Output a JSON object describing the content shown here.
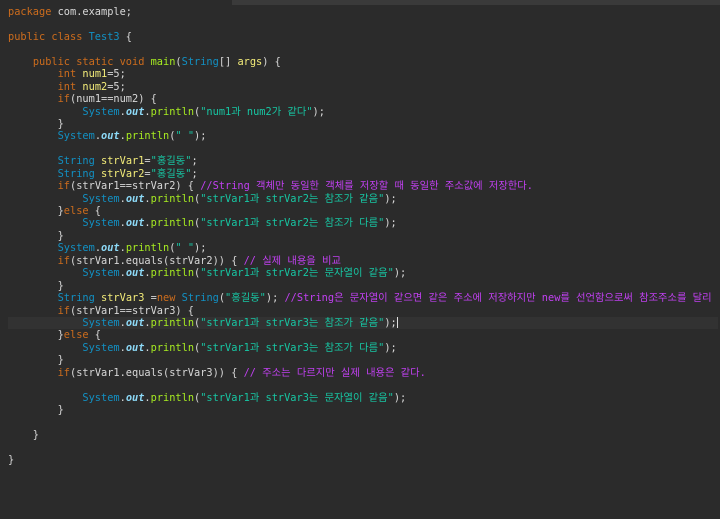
{
  "editor": {
    "language": "java",
    "colors": {
      "background": "#2b2b2b",
      "keyword": "#cc6c1d",
      "type": "#1290c3",
      "method": "#a7ec21",
      "variable": "#f3ec79",
      "field": "#8ddaf8",
      "string": "#17c6a3",
      "comment": "#c040f0"
    },
    "lines": [
      [
        [
          "kw",
          "package"
        ],
        [
          "tx",
          " com.example;"
        ]
      ],
      [],
      [
        [
          "kw",
          "public class"
        ],
        [
          "tx",
          " "
        ],
        [
          "ty",
          "Test3"
        ],
        [
          "tx",
          " {"
        ]
      ],
      [],
      [
        [
          "tx",
          "    "
        ],
        [
          "kw",
          "public static void"
        ],
        [
          "tx",
          " "
        ],
        [
          "fn",
          "main"
        ],
        [
          "tx",
          "("
        ],
        [
          "ty",
          "String"
        ],
        [
          "tx",
          "[] "
        ],
        [
          "var",
          "args"
        ],
        [
          "tx",
          ") {"
        ]
      ],
      [
        [
          "tx",
          "        "
        ],
        [
          "kw",
          "int"
        ],
        [
          "tx",
          " "
        ],
        [
          "var",
          "num1"
        ],
        [
          "tx",
          "=5;"
        ]
      ],
      [
        [
          "tx",
          "        "
        ],
        [
          "kw",
          "int"
        ],
        [
          "tx",
          " "
        ],
        [
          "var",
          "num2"
        ],
        [
          "tx",
          "=5;"
        ]
      ],
      [
        [
          "tx",
          "        "
        ],
        [
          "kw",
          "if"
        ],
        [
          "tx",
          "(num1==num2) {"
        ]
      ],
      [
        [
          "tx",
          "            "
        ],
        [
          "ty",
          "System"
        ],
        [
          "tx",
          "."
        ],
        [
          "fld",
          "out"
        ],
        [
          "tx",
          "."
        ],
        [
          "fn",
          "println"
        ],
        [
          "tx",
          "("
        ],
        [
          "str",
          "\"num1과 num2가 같다\""
        ],
        [
          "tx",
          ");"
        ]
      ],
      [
        [
          "tx",
          "        }"
        ]
      ],
      [
        [
          "tx",
          "        "
        ],
        [
          "ty",
          "System"
        ],
        [
          "tx",
          "."
        ],
        [
          "fld",
          "out"
        ],
        [
          "tx",
          "."
        ],
        [
          "fn",
          "println"
        ],
        [
          "tx",
          "("
        ],
        [
          "str",
          "\" \""
        ],
        [
          "tx",
          ");"
        ]
      ],
      [],
      [
        [
          "tx",
          "        "
        ],
        [
          "ty",
          "String"
        ],
        [
          "tx",
          " "
        ],
        [
          "var",
          "strVar1"
        ],
        [
          "tx",
          "="
        ],
        [
          "str",
          "\"홍길동\""
        ],
        [
          "tx",
          ";"
        ]
      ],
      [
        [
          "tx",
          "        "
        ],
        [
          "ty",
          "String"
        ],
        [
          "tx",
          " "
        ],
        [
          "var",
          "strVar2"
        ],
        [
          "tx",
          "="
        ],
        [
          "str",
          "\"홍길동\""
        ],
        [
          "tx",
          ";"
        ]
      ],
      [
        [
          "tx",
          "        "
        ],
        [
          "kw",
          "if"
        ],
        [
          "tx",
          "(strVar1==strVar2) { "
        ],
        [
          "cm",
          "//String 객체만 동일한 객체를 저장할 때 동일한 주소값에 저장한다."
        ]
      ],
      [
        [
          "tx",
          "            "
        ],
        [
          "ty",
          "System"
        ],
        [
          "tx",
          "."
        ],
        [
          "fld",
          "out"
        ],
        [
          "tx",
          "."
        ],
        [
          "fn",
          "println"
        ],
        [
          "tx",
          "("
        ],
        [
          "str",
          "\"strVar1과 strVar2는 참조가 같음\""
        ],
        [
          "tx",
          ");"
        ]
      ],
      [
        [
          "tx",
          "        }"
        ],
        [
          "kw",
          "else"
        ],
        [
          "tx",
          " {"
        ]
      ],
      [
        [
          "tx",
          "            "
        ],
        [
          "ty",
          "System"
        ],
        [
          "tx",
          "."
        ],
        [
          "fld",
          "out"
        ],
        [
          "tx",
          "."
        ],
        [
          "fn",
          "println"
        ],
        [
          "tx",
          "("
        ],
        [
          "str",
          "\"strVar1과 strVar2는 참조가 다름\""
        ],
        [
          "tx",
          ");"
        ]
      ],
      [
        [
          "tx",
          "        }"
        ]
      ],
      [
        [
          "tx",
          "        "
        ],
        [
          "ty",
          "System"
        ],
        [
          "tx",
          "."
        ],
        [
          "fld",
          "out"
        ],
        [
          "tx",
          "."
        ],
        [
          "fn",
          "println"
        ],
        [
          "tx",
          "("
        ],
        [
          "str",
          "\" \""
        ],
        [
          "tx",
          ");"
        ]
      ],
      [
        [
          "tx",
          "        "
        ],
        [
          "kw",
          "if"
        ],
        [
          "tx",
          "(strVar1.equals(strVar2)) { "
        ],
        [
          "cm",
          "// 실제 내용을 비교"
        ]
      ],
      [
        [
          "tx",
          "            "
        ],
        [
          "ty",
          "System"
        ],
        [
          "tx",
          "."
        ],
        [
          "fld",
          "out"
        ],
        [
          "tx",
          "."
        ],
        [
          "fn",
          "println"
        ],
        [
          "tx",
          "("
        ],
        [
          "str",
          "\"strVar1과 strVar2는 문자열이 같음\""
        ],
        [
          "tx",
          ");"
        ]
      ],
      [
        [
          "tx",
          "        }"
        ]
      ],
      [
        [
          "tx",
          "        "
        ],
        [
          "ty",
          "String"
        ],
        [
          "tx",
          " "
        ],
        [
          "var",
          "strVar3"
        ],
        [
          "tx",
          " ="
        ],
        [
          "kw",
          "new"
        ],
        [
          "tx",
          " "
        ],
        [
          "ty",
          "String"
        ],
        [
          "tx",
          "("
        ],
        [
          "str",
          "\"홍길동\""
        ],
        [
          "tx",
          "); "
        ],
        [
          "cm",
          "//String은 문자열이 같으면 같은 주소에 저장하지만 new를 선언함으로써 참조주소를 달리 저장시킬수 있다."
        ]
      ],
      [
        [
          "tx",
          "        "
        ],
        [
          "kw",
          "if"
        ],
        [
          "tx",
          "(strVar1==strVar3) {"
        ]
      ],
      [
        [
          "tx",
          "            "
        ],
        [
          "ty",
          "System"
        ],
        [
          "tx",
          "."
        ],
        [
          "fld",
          "out"
        ],
        [
          "tx",
          "."
        ],
        [
          "fn",
          "println"
        ],
        [
          "tx",
          "("
        ],
        [
          "str",
          "\"strVar1과 strVar3는 참조가 같음\""
        ],
        [
          "tx",
          ");"
        ]
      ],
      [
        [
          "tx",
          "        }"
        ],
        [
          "kw",
          "else"
        ],
        [
          "tx",
          " {"
        ]
      ],
      [
        [
          "tx",
          "            "
        ],
        [
          "ty",
          "System"
        ],
        [
          "tx",
          "."
        ],
        [
          "fld",
          "out"
        ],
        [
          "tx",
          "."
        ],
        [
          "fn",
          "println"
        ],
        [
          "tx",
          "("
        ],
        [
          "str",
          "\"strVar1과 strVar3는 참조가 다름\""
        ],
        [
          "tx",
          ");"
        ]
      ],
      [
        [
          "tx",
          "        }"
        ]
      ],
      [
        [
          "tx",
          "        "
        ],
        [
          "kw",
          "if"
        ],
        [
          "tx",
          "(strVar1.equals(strVar3)) { "
        ],
        [
          "cm",
          "// 주소는 다르지만 실제 내용은 같다."
        ]
      ],
      [],
      [
        [
          "tx",
          "            "
        ],
        [
          "ty",
          "System"
        ],
        [
          "tx",
          "."
        ],
        [
          "fld",
          "out"
        ],
        [
          "tx",
          "."
        ],
        [
          "fn",
          "println"
        ],
        [
          "tx",
          "("
        ],
        [
          "str",
          "\"strVar1과 strVar3는 문자열이 같음\""
        ],
        [
          "tx",
          ");"
        ]
      ],
      [
        [
          "tx",
          "        }"
        ]
      ],
      [],
      [
        [
          "tx",
          "    }"
        ]
      ],
      [],
      [
        [
          "tx",
          "}"
        ]
      ]
    ],
    "current_line": 25
  }
}
